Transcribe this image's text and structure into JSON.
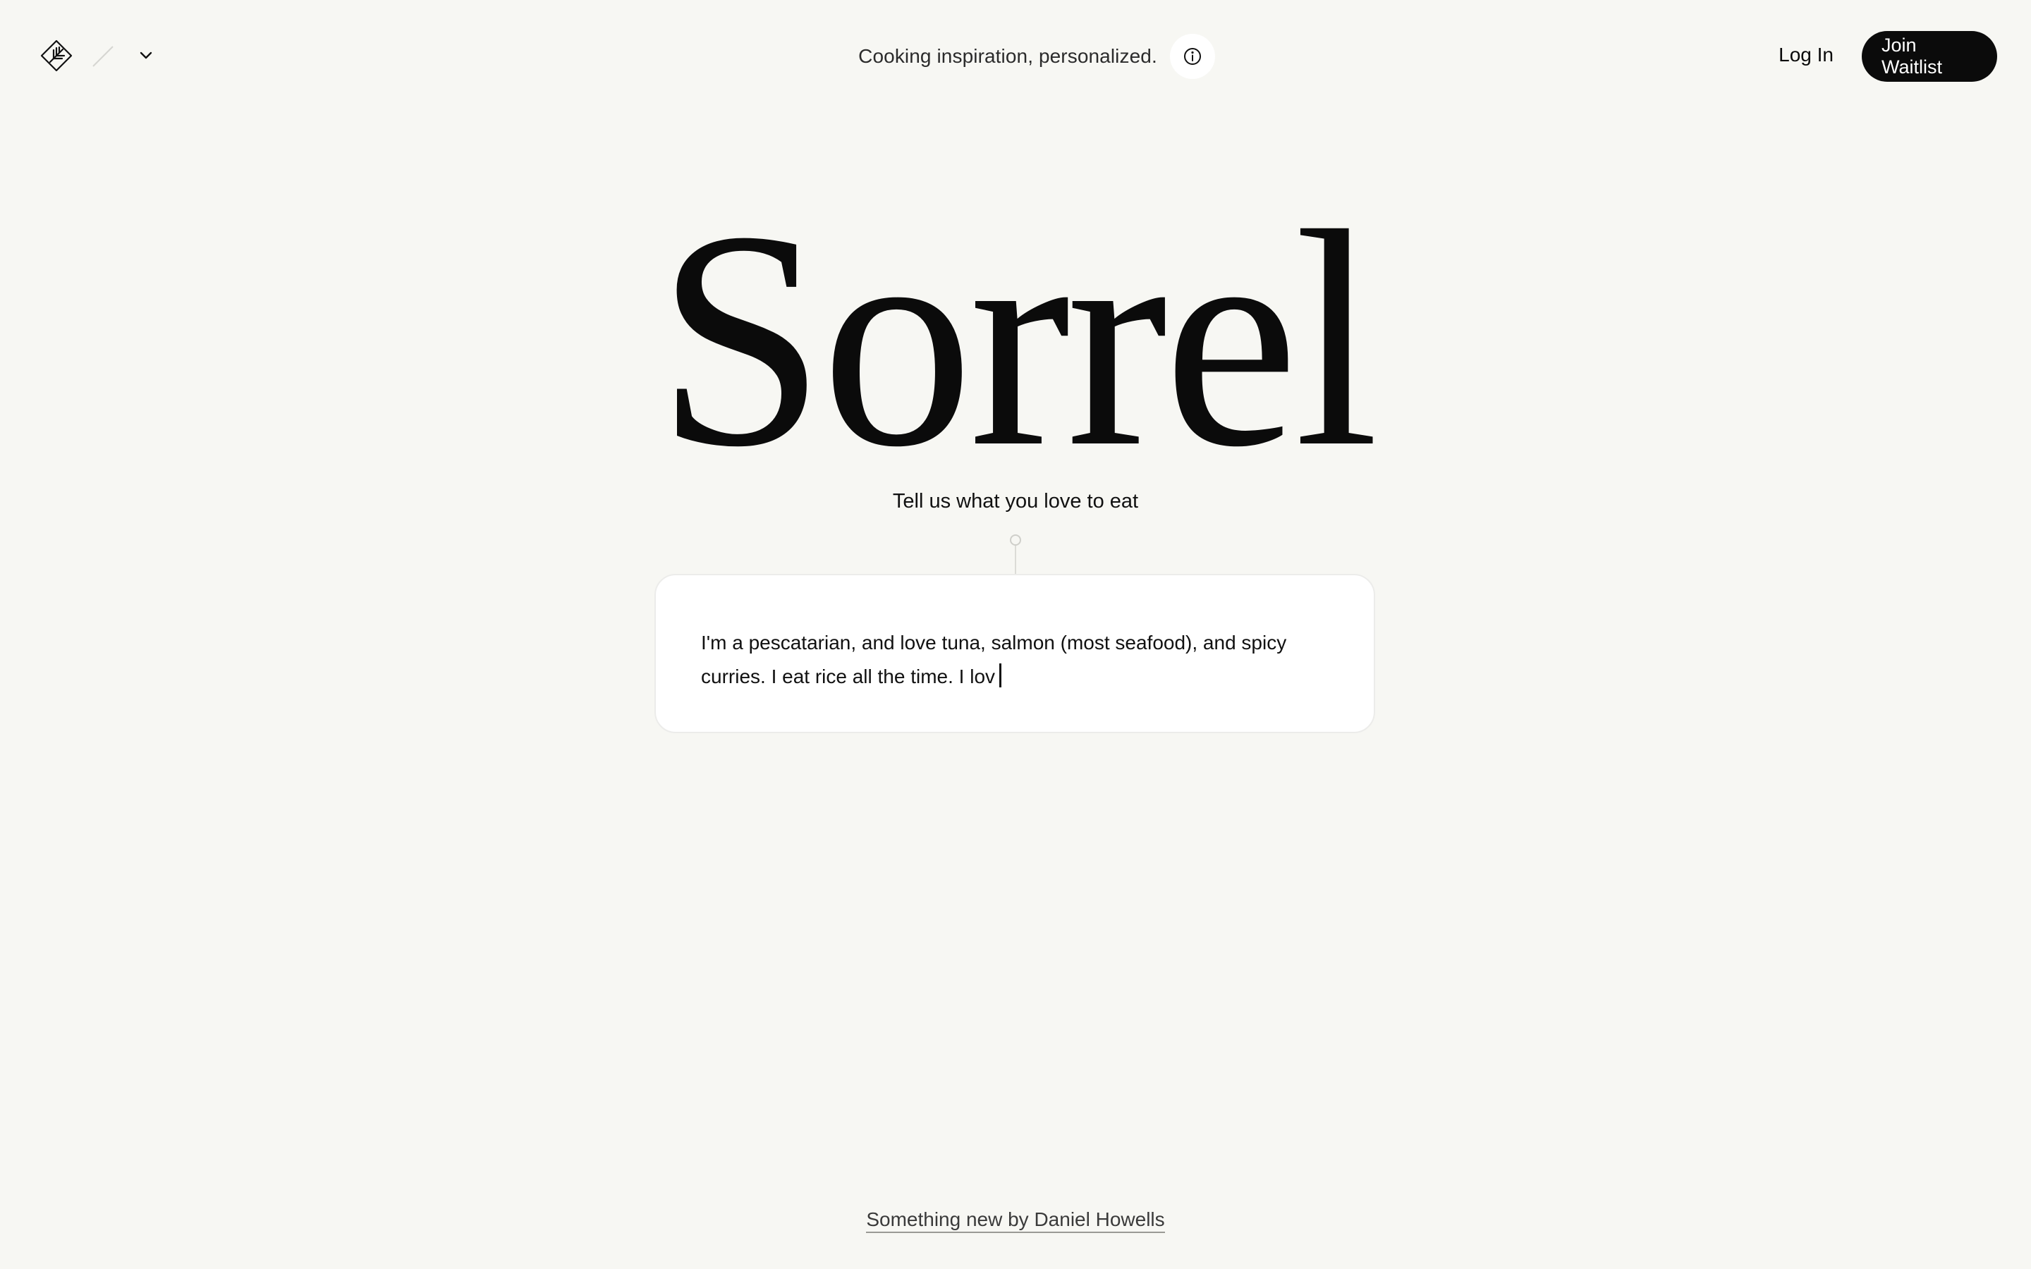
{
  "header": {
    "logo_icon": "sorrel-leaf-logo-icon",
    "separator_icon": "slash-separator-icon",
    "menu_icon": "chevron-down-icon",
    "tagline": "Cooking inspiration, personalized.",
    "info_icon": "info-circle-icon",
    "login_label": "Log In",
    "join_label": "Join Waitlist"
  },
  "hero": {
    "title": "Sorrel",
    "subtitle": "Tell us what you love to eat"
  },
  "prompt": {
    "value": "I'm a pescatarian, and love tuna, salmon (most seafood), and spicy\ncurries. I eat rice all the time. I lov"
  },
  "footer": {
    "link_label": "Something new by Daniel Howells"
  },
  "colors": {
    "background": "#f7f7f3",
    "text": "#0b0b0b",
    "button_bg": "#0b0b0b",
    "button_text": "#ffffff",
    "card_bg": "#ffffff"
  }
}
